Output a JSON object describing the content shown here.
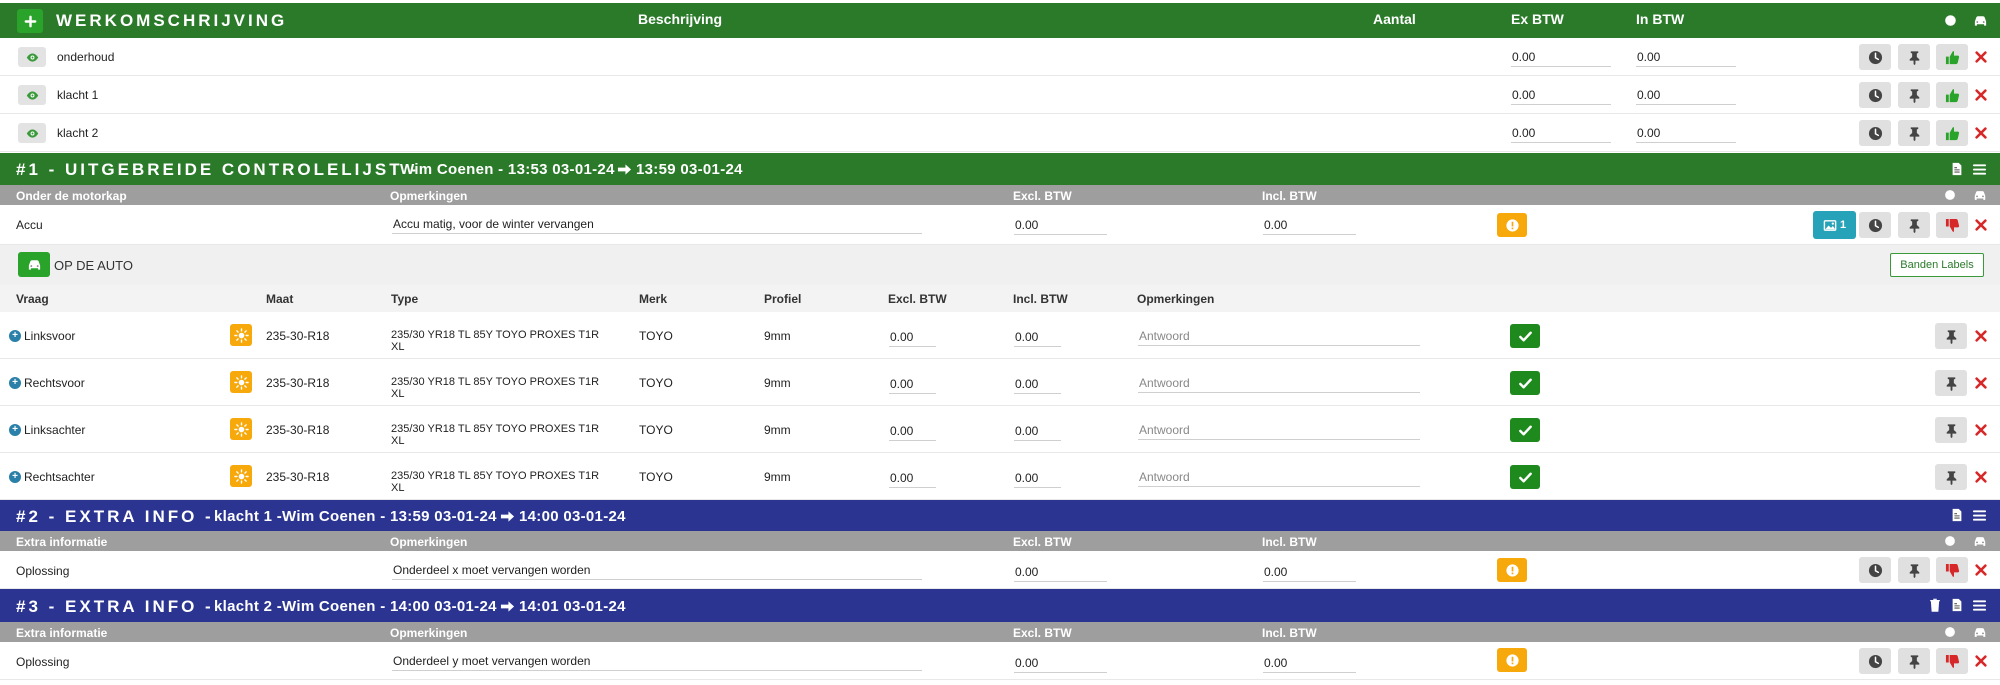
{
  "header": {
    "title": "WERKOMSCHRIJVING",
    "cols": {
      "beschrijving": "Beschrijving",
      "aantal": "Aantal",
      "ex_btw": "Ex BTW",
      "in_btw": "In BTW"
    }
  },
  "work_items": [
    {
      "label": "onderhoud",
      "ex": "0.00",
      "in": "0.00"
    },
    {
      "label": "klacht 1",
      "ex": "0.00",
      "in": "0.00"
    },
    {
      "label": "klacht 2",
      "ex": "0.00",
      "in": "0.00"
    }
  ],
  "section1": {
    "title": "#1 - UITGEBREIDE CONTROLELIJST -",
    "meta_start": "Wim Coenen - 13:53 03-01-24",
    "meta_end": "13:59 03-01-24",
    "cols": {
      "c1": "Onder de motorkap",
      "c2": "Opmerkingen",
      "c3": "Excl. BTW",
      "c4": "Incl. BTW"
    },
    "row": {
      "label": "Accu",
      "remark": "Accu matig, voor de winter vervangen",
      "excl": "0.00",
      "incl": "0.00",
      "photo_count": "1"
    },
    "car_group": {
      "label": "OP DE AUTO",
      "labels_button": "Banden Labels",
      "cols": {
        "vraag": "Vraag",
        "maat": "Maat",
        "type": "Type",
        "merk": "Merk",
        "profiel": "Profiel",
        "excl": "Excl. BTW",
        "incl": "Incl. BTW",
        "opm": "Opmerkingen"
      },
      "tires": [
        {
          "position": "Linksvoor",
          "size": "235-30-R18",
          "type_l1": "235/30 YR18 TL 85Y TOYO PROXES T1R",
          "type_l2": "XL",
          "brand": "TOYO",
          "profile": "9mm",
          "excl": "0.00",
          "incl": "0.00",
          "placeholder": "Antwoord"
        },
        {
          "position": "Rechtsvoor",
          "size": "235-30-R18",
          "type_l1": "235/30 YR18 TL 85Y TOYO PROXES T1R",
          "type_l2": "XL",
          "brand": "TOYO",
          "profile": "9mm",
          "excl": "0.00",
          "incl": "0.00",
          "placeholder": "Antwoord"
        },
        {
          "position": "Linksachter",
          "size": "235-30-R18",
          "type_l1": "235/30 YR18 TL 85Y TOYO PROXES T1R",
          "type_l2": "XL",
          "brand": "TOYO",
          "profile": "9mm",
          "excl": "0.00",
          "incl": "0.00",
          "placeholder": "Antwoord"
        },
        {
          "position": "Rechtsachter",
          "size": "235-30-R18",
          "type_l1": "235/30 YR18 TL 85Y TOYO PROXES T1R",
          "type_l2": "XL",
          "brand": "TOYO",
          "profile": "9mm",
          "excl": "0.00",
          "incl": "0.00",
          "placeholder": "Antwoord"
        }
      ]
    }
  },
  "section2": {
    "title": "#2 - EXTRA INFO -",
    "meta_start": "klacht 1 -Wim Coenen - 13:59 03-01-24",
    "meta_end": "14:00 03-01-24",
    "cols": {
      "c1": "Extra informatie",
      "c2": "Opmerkingen",
      "c3": "Excl. BTW",
      "c4": "Incl. BTW"
    },
    "row": {
      "label": "Oplossing",
      "remark": "Onderdeel x moet vervangen worden",
      "excl": "0.00",
      "incl": "0.00"
    }
  },
  "section3": {
    "title": "#3 - EXTRA INFO -",
    "meta_start": "klacht 2 -Wim Coenen - 14:00 03-01-24",
    "meta_end": "14:01 03-01-24",
    "cols": {
      "c1": "Extra informatie",
      "c2": "Opmerkingen",
      "c3": "Excl. BTW",
      "c4": "Incl. BTW"
    },
    "row": {
      "label": "Oplossing",
      "remark": "Onderdeel y moet vervangen worden",
      "excl": "0.00",
      "incl": "0.00"
    }
  },
  "colors": {
    "green_header": "#2a7a2a",
    "blue_header": "#2b3591",
    "grey_header": "#9e9e9e",
    "orange": "#f7a90c",
    "teal": "#26a3b8",
    "red": "#d62828",
    "thumb_green": "#29a329"
  }
}
